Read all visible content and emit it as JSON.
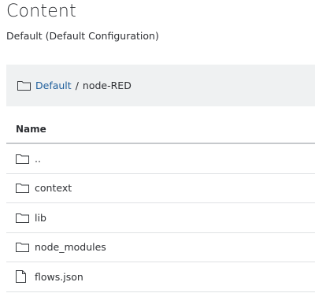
{
  "page": {
    "title": "Content",
    "subtitle": "Default (Default Configuration)"
  },
  "breadcrumb": {
    "root_label": "Default",
    "separator": "/",
    "current": "node-RED",
    "icon": "folder-icon"
  },
  "table": {
    "column_name": "Name",
    "rows": [
      {
        "label": "..",
        "type": "folder",
        "icon": "folder-icon"
      },
      {
        "label": "context",
        "type": "folder",
        "icon": "folder-icon"
      },
      {
        "label": "lib",
        "type": "folder",
        "icon": "folder-icon"
      },
      {
        "label": "node_modules",
        "type": "folder",
        "icon": "folder-icon"
      },
      {
        "label": "flows.json",
        "type": "file",
        "icon": "file-icon"
      }
    ]
  },
  "colors": {
    "link": "#1f5f9c",
    "breadcrumb_bg": "#eff1f2",
    "text": "#2e3034",
    "divider": "#dfe2e4"
  }
}
